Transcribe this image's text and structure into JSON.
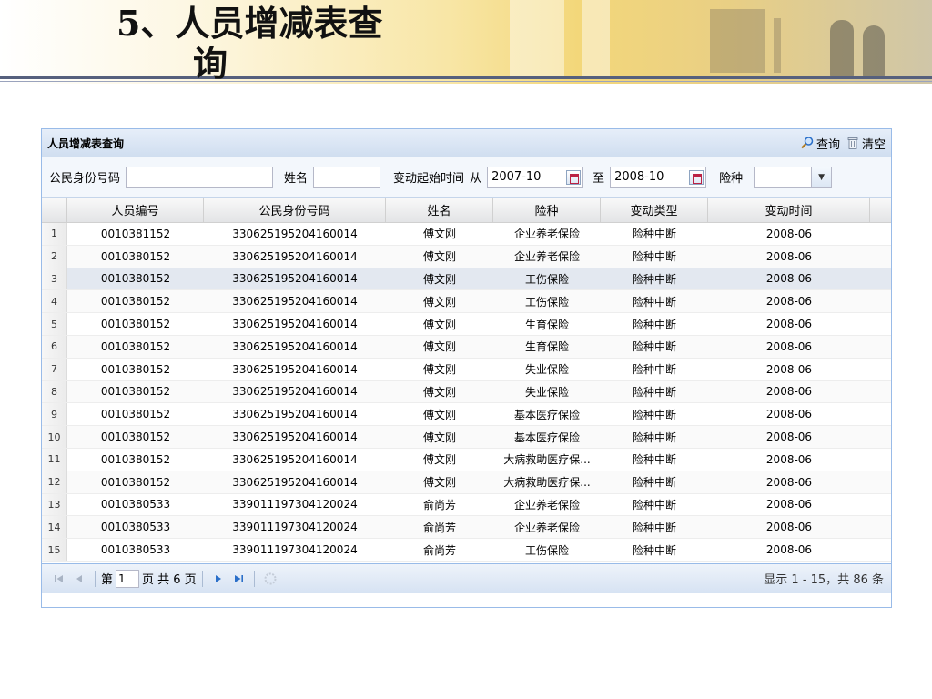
{
  "slide": {
    "title_line1": "5、人员增减表查",
    "title_line2": "询"
  },
  "panel": {
    "title": "人员增减表查询",
    "query_label": "查询",
    "clear_label": "清空"
  },
  "form": {
    "citizen_id_label": "公民身份号码",
    "citizen_id_value": "",
    "name_label": "姓名",
    "name_value": "",
    "change_start_label": "变动起始时间",
    "from_label": "从",
    "from_value": "2007-10",
    "to_label": "至",
    "to_value": "2008-10",
    "insurance_label": "险种",
    "insurance_value": ""
  },
  "grid": {
    "columns": [
      "人员编号",
      "公民身份号码",
      "姓名",
      "险种",
      "变动类型",
      "变动时间"
    ],
    "rows": [
      {
        "no": "1",
        "id": "0010381152",
        "card": "330625195204160014",
        "name": "傅文刚",
        "ins": "企业养老保险",
        "type": "险种中断",
        "time": "2008-06"
      },
      {
        "no": "2",
        "id": "0010380152",
        "card": "330625195204160014",
        "name": "傅文刚",
        "ins": "企业养老保险",
        "type": "险种中断",
        "time": "2008-06"
      },
      {
        "no": "3",
        "id": "0010380152",
        "card": "330625195204160014",
        "name": "傅文刚",
        "ins": "工伤保险",
        "type": "险种中断",
        "time": "2008-06"
      },
      {
        "no": "4",
        "id": "0010380152",
        "card": "330625195204160014",
        "name": "傅文刚",
        "ins": "工伤保险",
        "type": "险种中断",
        "time": "2008-06"
      },
      {
        "no": "5",
        "id": "0010380152",
        "card": "330625195204160014",
        "name": "傅文刚",
        "ins": "生育保险",
        "type": "险种中断",
        "time": "2008-06"
      },
      {
        "no": "6",
        "id": "0010380152",
        "card": "330625195204160014",
        "name": "傅文刚",
        "ins": "生育保险",
        "type": "险种中断",
        "time": "2008-06"
      },
      {
        "no": "7",
        "id": "0010380152",
        "card": "330625195204160014",
        "name": "傅文刚",
        "ins": "失业保险",
        "type": "险种中断",
        "time": "2008-06"
      },
      {
        "no": "8",
        "id": "0010380152",
        "card": "330625195204160014",
        "name": "傅文刚",
        "ins": "失业保险",
        "type": "险种中断",
        "time": "2008-06"
      },
      {
        "no": "9",
        "id": "0010380152",
        "card": "330625195204160014",
        "name": "傅文刚",
        "ins": "基本医疗保险",
        "type": "险种中断",
        "time": "2008-06"
      },
      {
        "no": "10",
        "id": "0010380152",
        "card": "330625195204160014",
        "name": "傅文刚",
        "ins": "基本医疗保险",
        "type": "险种中断",
        "time": "2008-06"
      },
      {
        "no": "11",
        "id": "0010380152",
        "card": "330625195204160014",
        "name": "傅文刚",
        "ins": "大病救助医疗保...",
        "type": "险种中断",
        "time": "2008-06"
      },
      {
        "no": "12",
        "id": "0010380152",
        "card": "330625195204160014",
        "name": "傅文刚",
        "ins": "大病救助医疗保...",
        "type": "险种中断",
        "time": "2008-06"
      },
      {
        "no": "13",
        "id": "0010380533",
        "card": "339011197304120024",
        "name": "俞尚芳",
        "ins": "企业养老保险",
        "type": "险种中断",
        "time": "2008-06"
      },
      {
        "no": "14",
        "id": "0010380533",
        "card": "339011197304120024",
        "name": "俞尚芳",
        "ins": "企业养老保险",
        "type": "险种中断",
        "time": "2008-06"
      },
      {
        "no": "15",
        "id": "0010380533",
        "card": "339011197304120024",
        "name": "俞尚芳",
        "ins": "工伤保险",
        "type": "险种中断",
        "time": "2008-06"
      }
    ]
  },
  "pager": {
    "page_prefix": "第",
    "page_value": "1",
    "page_suffix": "页 共 6 页",
    "info": "显示 1 - 15，共 86 条"
  },
  "colors": {
    "panel_border": "#99bbe8",
    "selected_row": "#e3e8f0",
    "icon_blue": "#2a6fc9"
  }
}
